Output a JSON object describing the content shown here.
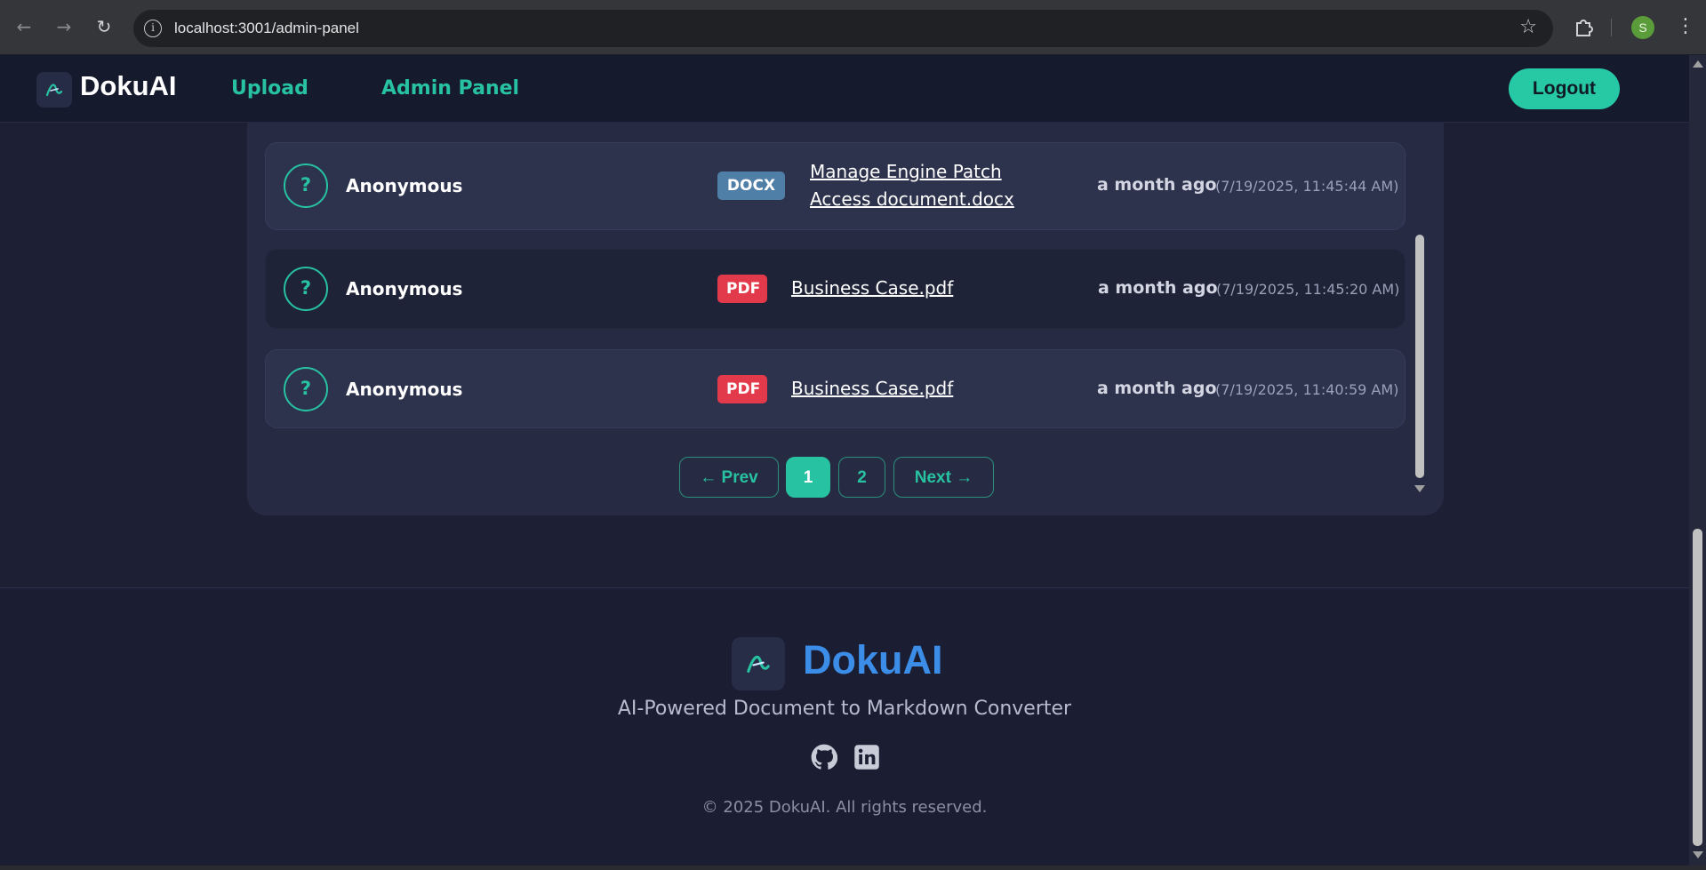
{
  "browser": {
    "url": "localhost:3001/admin-panel",
    "profile_initial": "S"
  },
  "header": {
    "brand": "DokuAI",
    "nav": [
      {
        "label": "Upload"
      },
      {
        "label": "Admin Panel"
      }
    ],
    "logout_label": "Logout"
  },
  "uploads": [
    {
      "user": "Anonymous",
      "avatar_symbol": "?",
      "type": "DOCX",
      "filename_lines": [
        "Manage Engine Patch",
        "Access document.docx"
      ],
      "relative_time": "a month ago",
      "timestamp": "(7/19/2025, 11:45:44 AM)"
    },
    {
      "user": "Anonymous",
      "avatar_symbol": "?",
      "type": "PDF",
      "filename": "Business Case.pdf",
      "relative_time": "a month ago",
      "timestamp": "(7/19/2025, 11:45:20 AM)"
    },
    {
      "user": "Anonymous",
      "avatar_symbol": "?",
      "type": "PDF",
      "filename": "Business Case.pdf",
      "relative_time": "a month ago",
      "timestamp": "(7/19/2025, 11:40:59 AM)"
    }
  ],
  "pagination": {
    "prev_label": "← Prev",
    "pages": [
      "1",
      "2"
    ],
    "current_page": "1",
    "next_label": "Next →"
  },
  "footer": {
    "brand": "DokuAI",
    "tagline": "AI-Powered Document to Markdown Converter",
    "social_icons": [
      "github-icon",
      "linkedin-icon"
    ],
    "copyright": "© 2025 DokuAI. All rights reserved."
  },
  "colors": {
    "accent": "#27c2a2",
    "docx_badge": "#4f7ea6",
    "pdf_badge": "#e23a4b",
    "footer_brand": "#3b8de8"
  }
}
